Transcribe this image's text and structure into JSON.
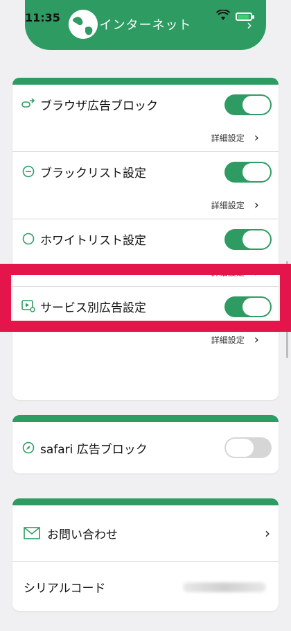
{
  "status_bar": {
    "time": "11:35"
  },
  "header": {
    "title": "インターネット"
  },
  "ad_block_card": {
    "rows": [
      {
        "label": "ブラウザ広告ブロック",
        "toggle": "on",
        "detail": "詳細設定"
      },
      {
        "label": "ブラックリスト設定",
        "toggle": "on",
        "detail": "詳細設定"
      },
      {
        "label": "ホワイトリスト設定",
        "toggle": "on",
        "detail": "詳細設定"
      },
      {
        "label": "サービス別広告設定",
        "toggle": "on",
        "detail": "詳細設定"
      }
    ]
  },
  "safari_card": {
    "label": "safari 広告ブロック",
    "toggle": "off"
  },
  "support_card": {
    "contact_label": "お問い合わせ",
    "serial_label": "シリアルコード"
  },
  "colors": {
    "brand_green": "#2e9c62",
    "highlight_red": "#e3154a",
    "toggle_off": "#d6d6d6"
  }
}
